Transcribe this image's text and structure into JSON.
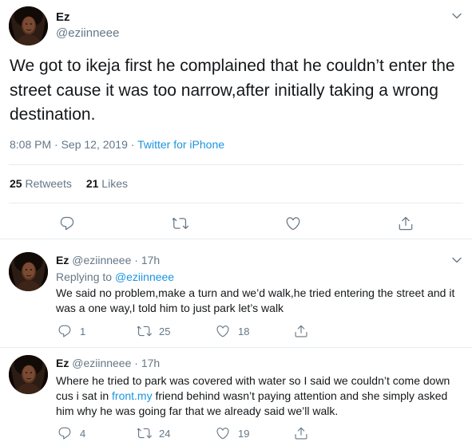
{
  "main_tweet": {
    "name": "Ez",
    "handle": "@eziinneee",
    "text": "We got to ikeja first he complained that he couldn’t enter the street cause it was too narrow,after initially taking a wrong destination.",
    "timestamp": "8:08 PM · Sep 12, 2019",
    "separator": " · ",
    "source": "Twitter for iPhone",
    "stats": {
      "retweets_count": "25",
      "retweets_label": "Retweets",
      "likes_count": "21",
      "likes_label": "Likes"
    }
  },
  "replies": [
    {
      "name": "Ez",
      "handle": "@eziinneee",
      "time": "· 17h",
      "replying_prefix": "Replying to",
      "replying_to": "@eziinneee",
      "text": "We said no problem,make a turn and we’d walk,he tried entering the street and it was a one way,I told him to just park let’s walk",
      "reply_count": "1",
      "retweet_count": "25",
      "like_count": "18"
    },
    {
      "name": "Ez",
      "handle": "@eziinneee",
      "time": "· 17h",
      "text_before_link": "Where he tried to park was covered with water so I said we couldn’t come down cus i sat in ",
      "link_text": "front.my",
      "text_after_link": " friend behind wasn’t paying attention and she simply asked him why he was going far that we already said we’ll walk.",
      "reply_count": "4",
      "retweet_count": "24",
      "like_count": "19"
    }
  ],
  "colors": {
    "text_primary": "#14171a",
    "text_secondary": "#657786",
    "link": "#1b95e0",
    "border": "#e6ecf0"
  },
  "icons": [
    "chevron-down-icon",
    "reply-icon",
    "retweet-icon",
    "like-icon",
    "share-icon"
  ]
}
